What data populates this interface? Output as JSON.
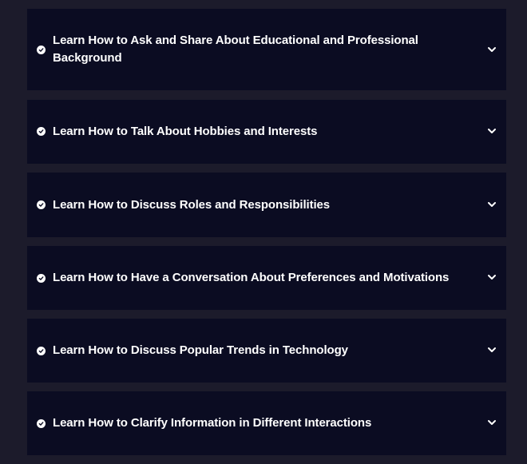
{
  "colors": {
    "page_background": "#1c1b2b",
    "item_background": "#0b0c22",
    "text": "#ffffff"
  },
  "icons": {
    "check": "check-circle-icon",
    "chevron": "chevron-down-icon"
  },
  "accordion": {
    "items": [
      {
        "title": "Learn How to Ask and Share About Educational and Professional Background"
      },
      {
        "title": "Learn How to Talk About Hobbies and Interests"
      },
      {
        "title": "Learn How to Discuss Roles and Responsibilities"
      },
      {
        "title": "Learn How to Have a Conversation About Preferences and Motivations"
      },
      {
        "title": "Learn How to Discuss Popular Trends in Technology"
      },
      {
        "title": "Learn How to Clarify Information in Different Interactions"
      }
    ]
  }
}
